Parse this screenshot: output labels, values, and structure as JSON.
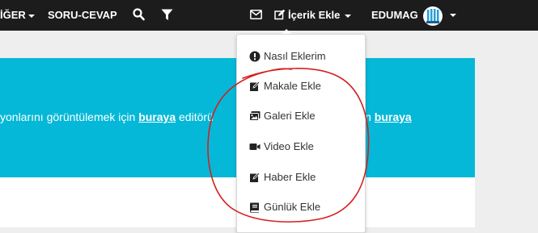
{
  "navbar": {
    "items": [
      {
        "label": "İĞER"
      },
      {
        "label": "SORU-CEVAP"
      }
    ],
    "icons": [
      "search-icon",
      "filter-icon",
      "envelope-icon",
      "edit-icon"
    ],
    "content_menu_label": "İçerik Ekle",
    "brand_label": "EDUMAG"
  },
  "banner": {
    "text_left": "yonlarını görüntülemek için ",
    "link1": "buraya",
    "text_mid": " editörü",
    "text_right": "in ",
    "link2": "buraya"
  },
  "dropdown": {
    "items": [
      {
        "label": "Nasıl Eklerim",
        "icon": "exclamation-circle-icon"
      },
      {
        "label": "Makale Ekle",
        "icon": "edit-icon"
      },
      {
        "label": "Galeri Ekle",
        "icon": "images-icon"
      },
      {
        "label": "Video Ekle",
        "icon": "video-icon"
      },
      {
        "label": "Haber Ekle",
        "icon": "edit-icon"
      },
      {
        "label": "Günlük Ekle",
        "icon": "book-icon"
      }
    ]
  },
  "colors": {
    "navbar": "#1c1c1c",
    "banner": "#05b8d7",
    "annotation": "#d42020"
  }
}
